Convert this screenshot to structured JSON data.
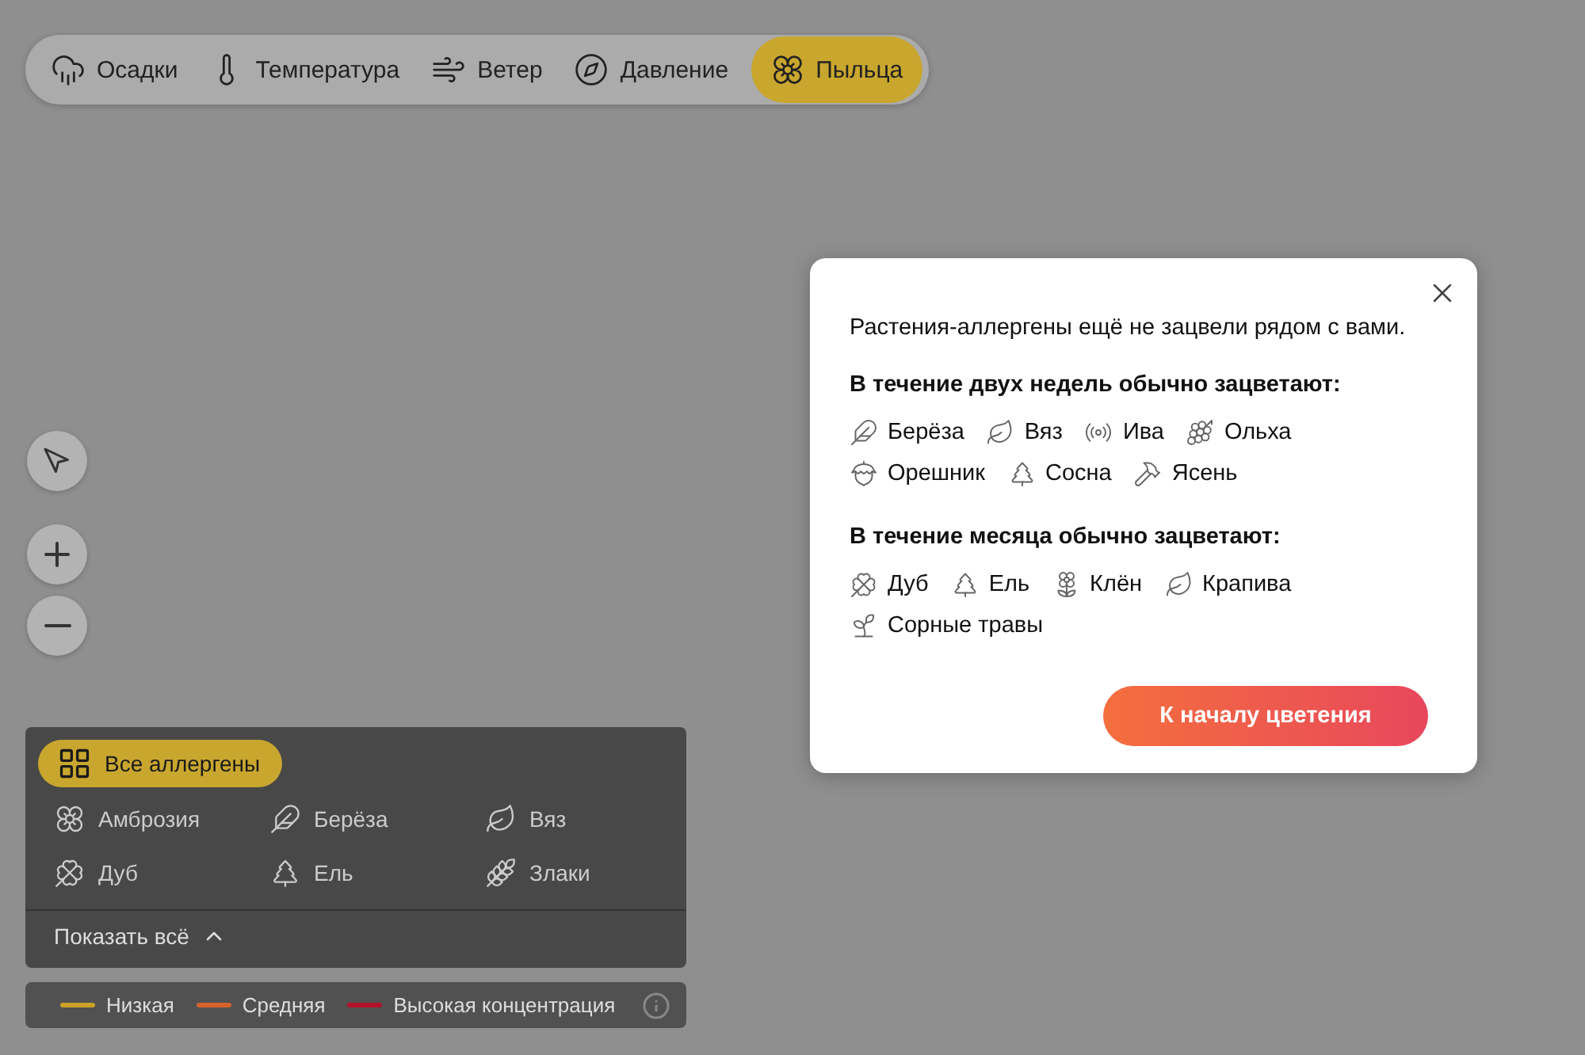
{
  "layers": [
    {
      "label": "Осадки",
      "kind": "rain",
      "selected": false
    },
    {
      "label": "Температура",
      "kind": "temperature",
      "selected": false
    },
    {
      "label": "Ветер",
      "kind": "wind",
      "selected": false
    },
    {
      "label": "Давление",
      "kind": "pressure",
      "selected": false
    },
    {
      "label": "Пыльца",
      "kind": "pollen",
      "selected": true
    }
  ],
  "popup": {
    "message": "Растения-аллергены ещё не зацвели рядом с вами.",
    "groups": [
      {
        "heading": "В течение двух недель обычно зацветают:",
        "plants": [
          {
            "label": "Берёза",
            "kind": "birch"
          },
          {
            "label": "Вяз",
            "kind": "elm"
          },
          {
            "label": "Ива",
            "kind": "willow"
          },
          {
            "label": "Ольха",
            "kind": "alder"
          },
          {
            "label": "Орешник",
            "kind": "hazel"
          },
          {
            "label": "Сосна",
            "kind": "pine"
          },
          {
            "label": "Ясень",
            "kind": "ash"
          }
        ]
      },
      {
        "heading": "В течение месяца обычно зацветают:",
        "plants": [
          {
            "label": "Дуб",
            "kind": "oak"
          },
          {
            "label": "Ель",
            "kind": "spruce"
          },
          {
            "label": "Клён",
            "kind": "maple"
          },
          {
            "label": "Крапива",
            "kind": "nettle"
          },
          {
            "label": "Сорные травы",
            "kind": "weeds"
          }
        ]
      }
    ],
    "button": "К началу цветения"
  },
  "allergens": {
    "all": {
      "label": "Все аллергены",
      "selected": true
    },
    "items": [
      {
        "label": "Амброзия",
        "kind": "ragweed",
        "selected": false
      },
      {
        "label": "Берёза",
        "kind": "birch",
        "selected": false
      },
      {
        "label": "Вяз",
        "kind": "elm",
        "selected": false
      },
      {
        "label": "Дуб",
        "kind": "oak",
        "selected": false
      },
      {
        "label": "Ель",
        "kind": "spruce",
        "selected": false
      },
      {
        "label": "Злаки",
        "kind": "grass",
        "selected": false
      }
    ],
    "show_all": "Показать всё"
  },
  "legend": [
    {
      "label": "Низкая",
      "color": "#c9a227"
    },
    {
      "label": "Средняя",
      "color": "#d4622a"
    },
    {
      "label": "Высокая концентрация",
      "color": "#b3122a"
    }
  ]
}
